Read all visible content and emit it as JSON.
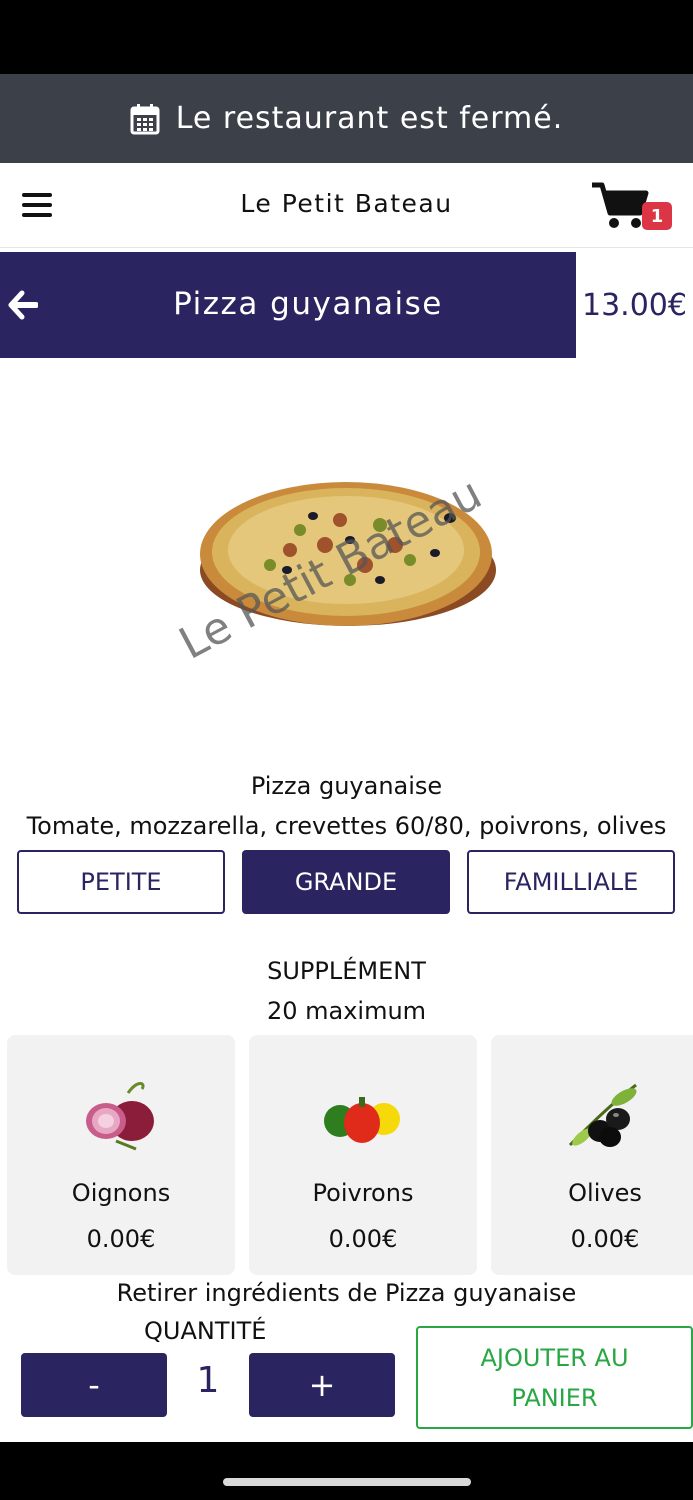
{
  "banner": {
    "text": "Le restaurant est fermé.",
    "icon": "calendar-icon"
  },
  "nav": {
    "brand": "Le Petit Bateau",
    "cart_count": "1",
    "menu_icon": "hamburger-icon",
    "cart_icon": "cart-icon"
  },
  "product": {
    "title": "Pizza guyanaise",
    "price": "13.00€",
    "name": "Pizza guyanaise",
    "description": "Tomate, mozzarella, crevettes 60/80, poivrons, olives",
    "watermark": "Le Petit Bateau"
  },
  "sizes": {
    "petite": "PETITE",
    "grande": "GRANDE",
    "familiale": "FAMILLIALE",
    "selected": "GRANDE"
  },
  "supplements": {
    "title": "SUPPLÉMENT",
    "max": "20 maximum",
    "items": [
      {
        "name": "Oignons",
        "price": "0.00€"
      },
      {
        "name": "Poivrons",
        "price": "0.00€"
      },
      {
        "name": "Olives",
        "price": "0.00€"
      }
    ]
  },
  "remove_ingredients": "Retirer ingrédients de Pizza guyanaise",
  "quantity": {
    "label": "QUANTITÉ",
    "value": "1",
    "minus": "-",
    "plus": "+"
  },
  "add_to_cart": {
    "line1": "AJOUTER AU",
    "line2": "PANIER"
  },
  "colors": {
    "primary": "#2a2460",
    "banner": "#3b4049",
    "success": "#28a745",
    "badge": "#dc3545"
  }
}
